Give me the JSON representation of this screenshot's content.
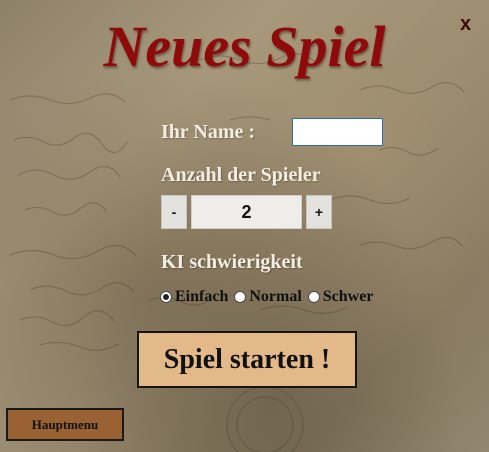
{
  "window": {
    "close_label": "x"
  },
  "title": "Neues Spiel",
  "form": {
    "name_label": "Ihr Name :",
    "name_value": "",
    "players_label": "Anzahl der Spieler",
    "players_minus": "-",
    "players_value": "2",
    "players_plus": "+",
    "ki_label": "KI schwierigkeit",
    "difficulty_options": [
      {
        "label": "Einfach",
        "selected": true
      },
      {
        "label": "Normal",
        "selected": false
      },
      {
        "label": "Schwer",
        "selected": false
      }
    ]
  },
  "start_button": "Spiel starten !",
  "menu_button": "Hauptmenu",
  "colors": {
    "title": "#8f0a0a",
    "label": "#f3ede2",
    "start_button_bg": "#e3b98a",
    "menu_button_bg": "#9a6233",
    "input_border": "#2c6fb1"
  }
}
